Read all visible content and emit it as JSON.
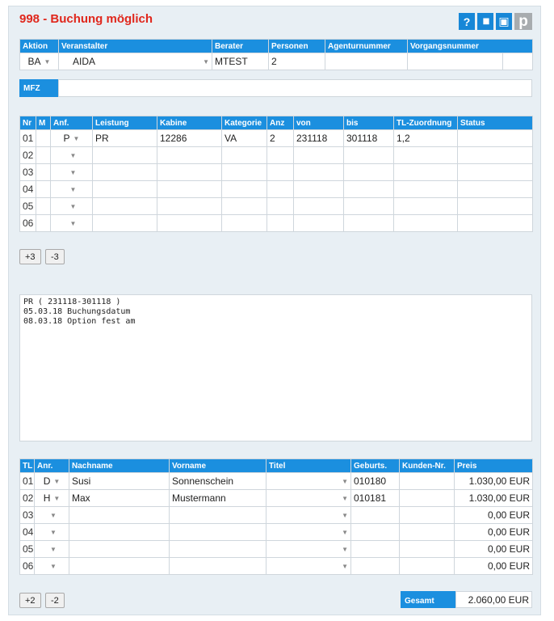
{
  "title": "998 - Buchung möglich",
  "toolbar": [
    {
      "name": "help-icon",
      "glyph": "?"
    },
    {
      "name": "binoculars-icon",
      "glyph": "▮▮"
    },
    {
      "name": "save-icon",
      "glyph": "▣"
    },
    {
      "name": "p-logo-icon",
      "glyph": "p"
    }
  ],
  "header_table": {
    "columns": [
      "Aktion",
      "Veranstalter",
      "Berater",
      "Personen",
      "Agenturnummer",
      "Vorgangsnummer"
    ],
    "row": {
      "aktion": "BA",
      "veranstalter": "AIDA",
      "berater": "MTEST",
      "personen": "2",
      "agenturnummer": "",
      "vorgangsnummer": ""
    }
  },
  "mfz": {
    "label": "MFZ",
    "value": ""
  },
  "services": {
    "columns": [
      "Nr",
      "M",
      "Anf.",
      "Leistung",
      "Kabine",
      "Kategorie",
      "Anz",
      "von",
      "bis",
      "TL-Zuordnung",
      "Status"
    ],
    "rows": [
      {
        "nr": "01",
        "m": "",
        "anf": "P",
        "leistung": "PR",
        "kabine": "12286",
        "kategorie": "VA",
        "anz": "2",
        "von": "231118",
        "bis": "301118",
        "tl": "1,2",
        "status": ""
      },
      {
        "nr": "02",
        "m": "",
        "anf": "",
        "leistung": "",
        "kabine": "",
        "kategorie": "",
        "anz": "",
        "von": "",
        "bis": "",
        "tl": "",
        "status": ""
      },
      {
        "nr": "03",
        "m": "",
        "anf": "",
        "leistung": "",
        "kabine": "",
        "kategorie": "",
        "anz": "",
        "von": "",
        "bis": "",
        "tl": "",
        "status": ""
      },
      {
        "nr": "04",
        "m": "",
        "anf": "",
        "leistung": "",
        "kabine": "",
        "kategorie": "",
        "anz": "",
        "von": "",
        "bis": "",
        "tl": "",
        "status": ""
      },
      {
        "nr": "05",
        "m": "",
        "anf": "",
        "leistung": "",
        "kabine": "",
        "kategorie": "",
        "anz": "",
        "von": "",
        "bis": "",
        "tl": "",
        "status": ""
      },
      {
        "nr": "06",
        "m": "",
        "anf": "",
        "leistung": "",
        "kabine": "",
        "kategorie": "",
        "anz": "",
        "von": "",
        "bis": "",
        "tl": "",
        "status": ""
      }
    ],
    "add_label": "+3",
    "remove_label": "-3"
  },
  "info_text": "PR ( 231118-301118 )\n05.03.18 Buchungsdatum\n08.03.18 Option fest am",
  "travelers": {
    "columns": [
      "TL",
      "Anr.",
      "Nachname",
      "Vorname",
      "Titel",
      "Geburts.",
      "Kunden-Nr.",
      "Preis"
    ],
    "rows": [
      {
        "tl": "01",
        "anr": "D",
        "nachname": "Susi",
        "vorname": "Sonnenschein",
        "titel": "",
        "geburts": "010180",
        "kunden": "",
        "preis": "1.030,00 EUR"
      },
      {
        "tl": "02",
        "anr": "H",
        "nachname": "Max",
        "vorname": "Mustermann",
        "titel": "",
        "geburts": "010181",
        "kunden": "",
        "preis": "1.030,00 EUR"
      },
      {
        "tl": "03",
        "anr": "",
        "nachname": "",
        "vorname": "",
        "titel": "",
        "geburts": "",
        "kunden": "",
        "preis": "0,00 EUR"
      },
      {
        "tl": "04",
        "anr": "",
        "nachname": "",
        "vorname": "",
        "titel": "",
        "geburts": "",
        "kunden": "",
        "preis": "0,00 EUR"
      },
      {
        "tl": "05",
        "anr": "",
        "nachname": "",
        "vorname": "",
        "titel": "",
        "geburts": "",
        "kunden": "",
        "preis": "0,00 EUR"
      },
      {
        "tl": "06",
        "anr": "",
        "nachname": "",
        "vorname": "",
        "titel": "",
        "geburts": "",
        "kunden": "",
        "preis": "0,00 EUR"
      }
    ],
    "add_label": "+2",
    "remove_label": "-2"
  },
  "total": {
    "label": "Gesamt",
    "value": "2.060,00 EUR"
  }
}
